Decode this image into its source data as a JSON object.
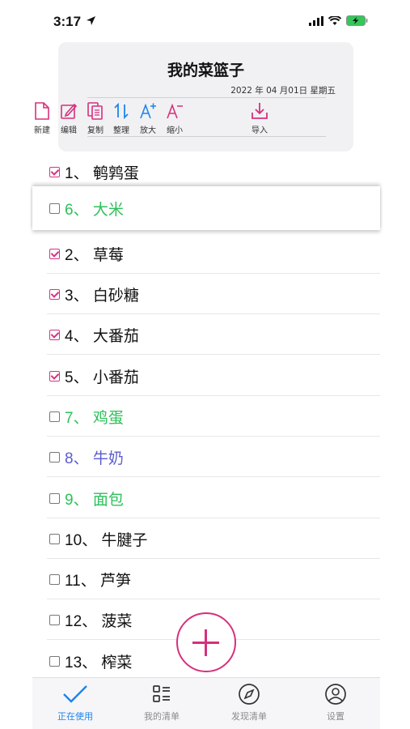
{
  "status_bar": {
    "time": "3:17"
  },
  "header": {
    "title": "我的菜篮子",
    "date": "2022 年 04 月01日  星期五",
    "toolbar": [
      {
        "label": "新建",
        "icon": "new-document-icon"
      },
      {
        "label": "编辑",
        "icon": "edit-icon"
      },
      {
        "label": "复制",
        "icon": "copy-icon"
      },
      {
        "label": "整理",
        "icon": "sort-icon"
      },
      {
        "label": "放大",
        "icon": "font-increase-icon"
      },
      {
        "label": "缩小",
        "icon": "font-decrease-icon"
      },
      {
        "label": "导入",
        "icon": "import-icon"
      }
    ]
  },
  "list": {
    "items": [
      {
        "text": "1、 鹌鹑蛋",
        "checked": true,
        "color": "#111111"
      },
      {
        "text": "2、 草莓",
        "checked": true,
        "color": "#111111"
      },
      {
        "text": "3、 白砂糖",
        "checked": true,
        "color": "#111111"
      },
      {
        "text": "4、 大番茄",
        "checked": true,
        "color": "#111111"
      },
      {
        "text": "5、 小番茄",
        "checked": true,
        "color": "#111111"
      },
      {
        "text": "7、 鸡蛋",
        "checked": false,
        "color": "#2ec05a"
      },
      {
        "text": "8、 牛奶",
        "checked": false,
        "color": "#5b5bd0"
      },
      {
        "text": "9、 面包",
        "checked": false,
        "color": "#2ec05a"
      },
      {
        "text": "10、 牛腱子",
        "checked": false,
        "color": "#111111"
      },
      {
        "text": "11、 芦笋",
        "checked": false,
        "color": "#111111"
      },
      {
        "text": "12、 菠菜",
        "checked": false,
        "color": "#111111"
      },
      {
        "text": "13、 榨菜",
        "checked": false,
        "color": "#111111"
      }
    ],
    "dragging": {
      "text": "6、 大米",
      "checked": false,
      "color": "#2ec05a"
    }
  },
  "tabbar": {
    "tabs": [
      {
        "label": "正在使用",
        "icon": "checkmark-icon",
        "active": true
      },
      {
        "label": "我的清单",
        "icon": "list-icon",
        "active": false
      },
      {
        "label": "发现清单",
        "icon": "compass-icon",
        "active": false
      },
      {
        "label": "设置",
        "icon": "person-icon",
        "active": false
      }
    ]
  },
  "colors": {
    "accent": "#d6307e",
    "tab_active": "#1c84f0",
    "green": "#2ec05a",
    "purple": "#5b5bd0"
  }
}
